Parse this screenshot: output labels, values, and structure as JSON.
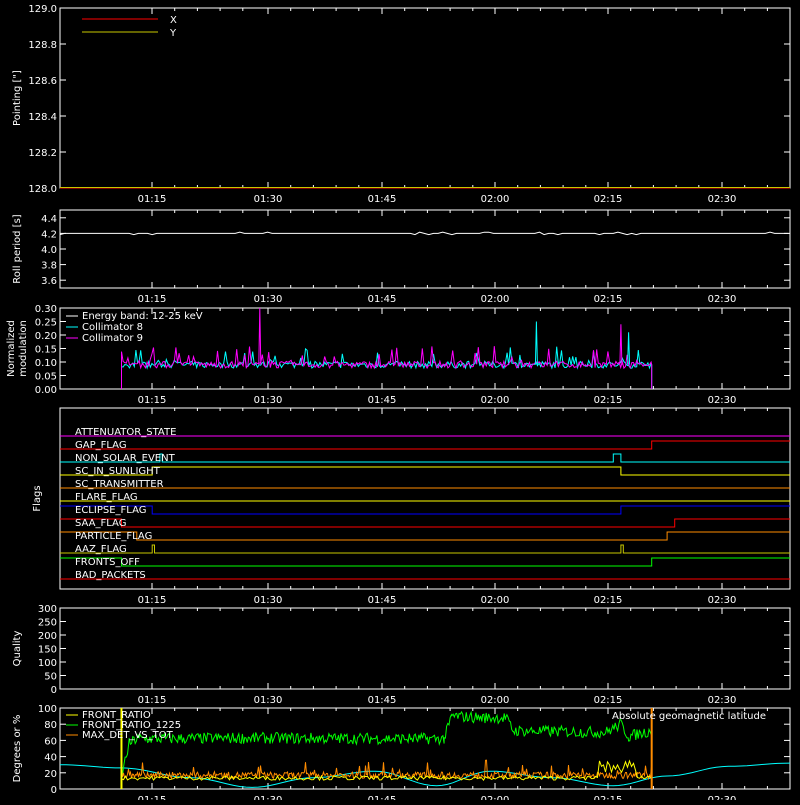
{
  "time_ticks": [
    "01:15",
    "01:30",
    "01:45",
    "02:00",
    "02:15",
    "02:30"
  ],
  "colors": {
    "axis": "#ffffff",
    "x": "#ff0000",
    "y": "#c8c800",
    "white": "#ffffff",
    "cyan": "#00ffff",
    "magenta": "#ff00ff",
    "green": "#00ff00",
    "orange": "#ff8c00",
    "yellow": "#ffff00",
    "blue": "#0000ff"
  },
  "chart_data": [
    {
      "type": "line",
      "ylabel": "Pointing [\"]",
      "ylim": [
        128.0,
        129.0
      ],
      "yticks": [
        "128.0",
        "128.2",
        "128.4",
        "128.6",
        "128.8",
        "129.0"
      ],
      "legend": [
        "X",
        "Y"
      ],
      "series": [
        {
          "name": "X",
          "x": [
            "01:05",
            "02:40"
          ],
          "values": [
            128.0,
            128.0
          ]
        },
        {
          "name": "Y",
          "x": [
            "01:05",
            "02:40"
          ],
          "values": [
            128.0,
            128.0
          ]
        }
      ]
    },
    {
      "type": "line",
      "ylabel": "Roll period [s]",
      "ylim": [
        3.5,
        4.5
      ],
      "yticks": [
        "3.6",
        "3.8",
        "4.0",
        "4.2",
        "4.4"
      ],
      "series": [
        {
          "x": [
            "01:05",
            "02:40"
          ],
          "values": [
            4.2,
            4.2
          ]
        }
      ]
    },
    {
      "type": "line",
      "ylabel": "Normalized modulation",
      "ylim": [
        0.0,
        0.3
      ],
      "yticks": [
        "0.00",
        "0.05",
        "0.10",
        "0.15",
        "0.20",
        "0.25",
        "0.30"
      ],
      "legend": [
        "Energy band: 12-25 keV",
        "Collimator 8",
        "Collimator 9"
      ],
      "data_start": "01:13",
      "data_end": "02:22",
      "baseline": 0.09,
      "spikes": [
        {
          "series": "Collimator 9",
          "x": "01:31",
          "value": 0.3
        },
        {
          "series": "Collimator 8",
          "x": "02:07",
          "value": 0.25
        },
        {
          "series": "Collimator 9",
          "x": "02:18",
          "value": 0.24
        },
        {
          "series": "Collimator 8",
          "x": "02:19",
          "value": 0.21
        }
      ]
    },
    {
      "type": "line",
      "ylabel": "Flags",
      "flags": [
        {
          "name": "ATTENUATOR_STATE",
          "color": "#ff00ff",
          "steps": [
            [
              "01:05",
              0
            ],
            [
              "02:40",
              0
            ]
          ]
        },
        {
          "name": "GAP_FLAG",
          "color": "#ff0000",
          "steps": [
            [
              "01:05",
              0
            ],
            [
              "02:22",
              1
            ],
            [
              "02:40",
              1
            ]
          ]
        },
        {
          "name": "NON_SOLAR_EVENT",
          "color": "#00ffff",
          "steps": [
            [
              "01:05",
              0
            ],
            [
              "01:18",
              1
            ],
            [
              "01:18.3",
              0
            ],
            [
              "02:17",
              1
            ],
            [
              "02:18",
              0
            ],
            [
              "02:40",
              0
            ]
          ]
        },
        {
          "name": "SC_IN_SUNLIGHT",
          "color": "#ffff00",
          "steps": [
            [
              "01:05",
              0
            ],
            [
              "01:17",
              1
            ],
            [
              "02:18",
              0
            ],
            [
              "02:40",
              0
            ]
          ]
        },
        {
          "name": "SC_TRANSMITTER",
          "color": "#ff8c00",
          "steps": [
            [
              "01:05",
              0
            ],
            [
              "02:40",
              0
            ]
          ]
        },
        {
          "name": "FLARE_FLAG",
          "color": "#ffff00",
          "steps": [
            [
              "01:05",
              0
            ],
            [
              "02:40",
              0
            ]
          ]
        },
        {
          "name": "ECLIPSE_FLAG",
          "color": "#0000ff",
          "steps": [
            [
              "01:05",
              1
            ],
            [
              "01:17",
              0
            ],
            [
              "02:18",
              1
            ],
            [
              "02:40",
              1
            ]
          ]
        },
        {
          "name": "SAA_FLAG",
          "color": "#ff0000",
          "steps": [
            [
              "01:05",
              1
            ],
            [
              "01:13",
              0
            ],
            [
              "02:25",
              1
            ],
            [
              "02:40",
              1
            ]
          ]
        },
        {
          "name": "PARTICLE_FLAG",
          "color": "#ff8c00",
          "steps": [
            [
              "01:05",
              1
            ],
            [
              "01:15",
              0
            ],
            [
              "02:24",
              1
            ],
            [
              "02:40",
              1
            ]
          ]
        },
        {
          "name": "AAZ_FLAG",
          "color": "#c8c800",
          "steps": [
            [
              "01:05",
              0
            ],
            [
              "01:17",
              1
            ],
            [
              "01:17.3",
              0
            ],
            [
              "02:18",
              1
            ],
            [
              "02:18.3",
              0
            ],
            [
              "02:40",
              0
            ]
          ]
        },
        {
          "name": "FRONTS_OFF",
          "color": "#00ff00",
          "steps": [
            [
              "01:05",
              1
            ],
            [
              "01:13",
              0
            ],
            [
              "02:22",
              1
            ],
            [
              "02:40",
              1
            ]
          ]
        },
        {
          "name": "BAD_PACKETS",
          "color": "#ff0000",
          "steps": [
            [
              "01:05",
              0
            ],
            [
              "02:40",
              0
            ]
          ]
        }
      ]
    },
    {
      "type": "line",
      "ylabel": "Quality",
      "ylim": [
        0,
        300
      ],
      "yticks": [
        "0",
        "50",
        "100",
        "150",
        "200",
        "250",
        "300"
      ],
      "series": []
    },
    {
      "type": "line",
      "ylabel": "Degrees or %",
      "ylim": [
        0,
        100
      ],
      "yticks": [
        "0",
        "20",
        "40",
        "60",
        "80",
        "100"
      ],
      "legend": [
        "FRONT_RATIO",
        "FRONT_RATIO_1225",
        "MAX_DET_VS_TOT"
      ],
      "annotation": "Absolute geomagnetic latitude",
      "markers": [
        {
          "color": "#ffff00",
          "x": "01:13"
        },
        {
          "color": "#ff8c00",
          "x": "02:22"
        }
      ],
      "latitude": {
        "name": "Absolute geomagnetic latitude",
        "x": [
          "01:05",
          "01:13",
          "01:22",
          "01:30",
          "01:38",
          "01:46",
          "01:54",
          "02:01",
          "02:09",
          "02:17",
          "02:24",
          "02:32",
          "02:40"
        ],
        "values": [
          30,
          26,
          14,
          2,
          14,
          22,
          4,
          22,
          14,
          4,
          16,
          28,
          32
        ]
      },
      "front_ratio_1225": {
        "x": [
          "01:13",
          "01:14",
          "01:15",
          "01:30",
          "01:55",
          "01:56",
          "02:00",
          "02:03",
          "02:04",
          "02:16",
          "02:18",
          "02:19",
          "02:22"
        ],
        "values": [
          16,
          56,
          62,
          63,
          62,
          90,
          88,
          88,
          72,
          70,
          80,
          65,
          72
        ]
      }
    }
  ]
}
